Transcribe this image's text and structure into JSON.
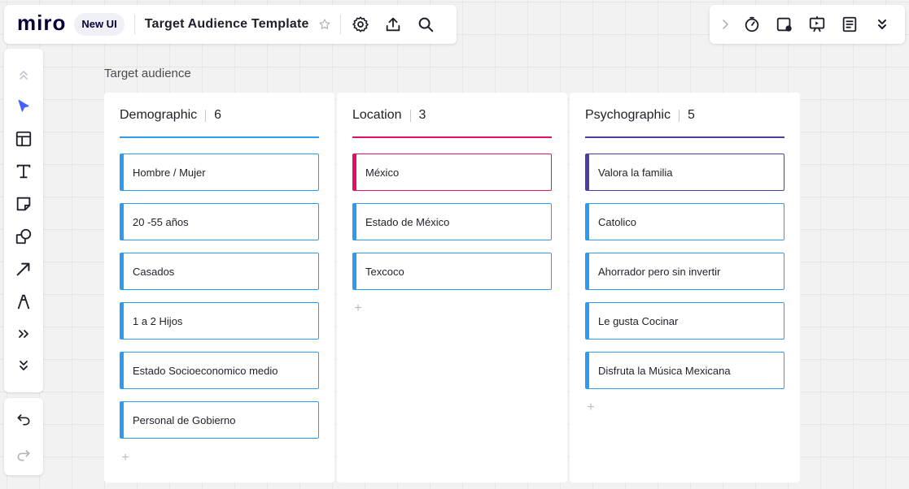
{
  "app": {
    "logo": "miro",
    "badge": "New UI",
    "board_title": "Target Audience Template"
  },
  "topbar_icons": [
    "star-icon",
    "settings-icon",
    "upload-icon",
    "search-icon"
  ],
  "topright_icons": [
    "chevron-right-icon",
    "timer-icon",
    "reactions-icon",
    "present-icon",
    "notes-icon",
    "chevrons-down-icon"
  ],
  "palette_icons": [
    "collapse-up-icon",
    "cursor-icon",
    "templates-icon",
    "text-icon",
    "sticky-note-icon",
    "shapes-icon",
    "connector-arrow-icon",
    "pen-icon",
    "more-tools-icon",
    "expand-down-icon"
  ],
  "history_icons": [
    "undo-icon",
    "redo-icon"
  ],
  "frame": {
    "label": "Target audience"
  },
  "colors": {
    "accent_blue": "#2d9bf0",
    "accent_magenta": "#e0106a",
    "accent_indigo": "#4b3fa6",
    "cursor_blue": "#4262ff"
  },
  "columns": [
    {
      "title": "Demographic",
      "count": "6",
      "cards": [
        "Hombre / Mujer",
        "20 -55 años",
        "Casados",
        "1 a 2 Hijos",
        "Estado Socioeconomico medio",
        "Personal de Gobierno"
      ],
      "add_label": "+"
    },
    {
      "title": "Location",
      "count": "3",
      "cards": [
        "México",
        "Estado de México",
        "Texcoco"
      ],
      "add_label": "+"
    },
    {
      "title": "Psychographic",
      "count": "5",
      "cards": [
        "Valora la familia",
        "Catolico",
        "Ahorrador pero sin invertir",
        "Le gusta Cocinar",
        "Disfruta la Música Mexicana"
      ],
      "add_label": "+"
    }
  ]
}
